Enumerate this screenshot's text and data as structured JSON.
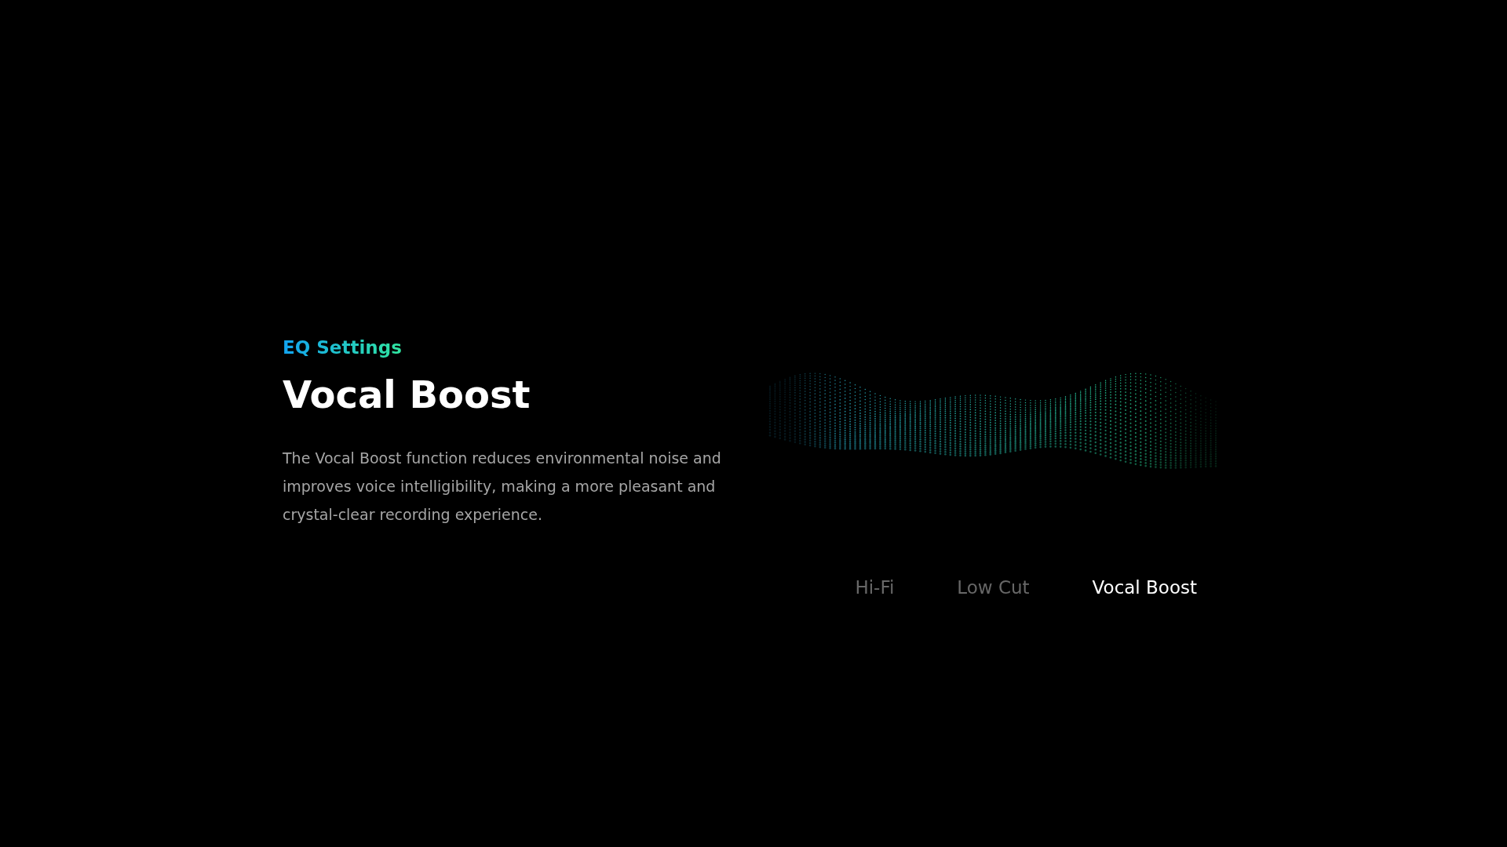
{
  "section": {
    "eyebrow": "EQ Settings",
    "title": "Vocal Boost",
    "description": "The Vocal Boost function reduces environmental noise and improves voice intelligibility, making a more pleasant and crystal-clear recording experience."
  },
  "tabs": [
    {
      "label": "Hi-Fi",
      "selected": false
    },
    {
      "label": "Low Cut",
      "selected": false
    },
    {
      "label": "Vocal Boost",
      "selected": true
    }
  ]
}
